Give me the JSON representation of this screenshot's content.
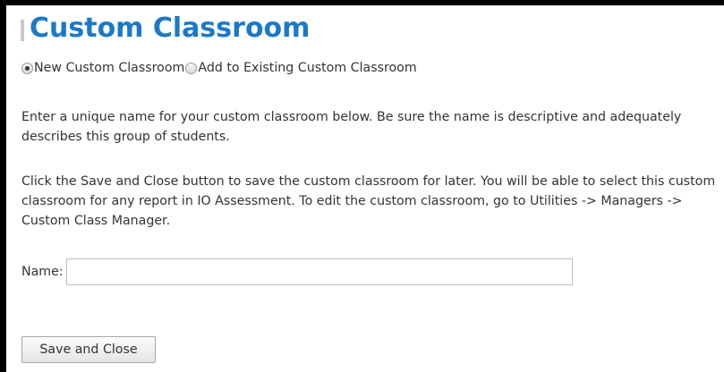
{
  "page": {
    "title": "Custom Classroom"
  },
  "mode": {
    "options": [
      {
        "label": "New Custom Classroom",
        "checked": true
      },
      {
        "label": "Add to Existing Custom Classroom",
        "checked": false
      }
    ]
  },
  "instructions": {
    "paragraph1": "Enter a unique name for your custom classroom below. Be sure the name is descriptive and adequately describes this group of students.",
    "paragraph2": "Click the Save and Close button to save the custom classroom for later. You will be able to select this custom classroom for any report in IO Assessment. To edit the custom classroom, go to Utilities -> Managers -> Custom Class Manager."
  },
  "form": {
    "name_label": "Name:",
    "name_value": "",
    "name_placeholder": ""
  },
  "actions": {
    "save_label": "Save and Close"
  },
  "colors": {
    "title": "#1b79c7",
    "text": "#333333",
    "frame_border": "#000000"
  }
}
